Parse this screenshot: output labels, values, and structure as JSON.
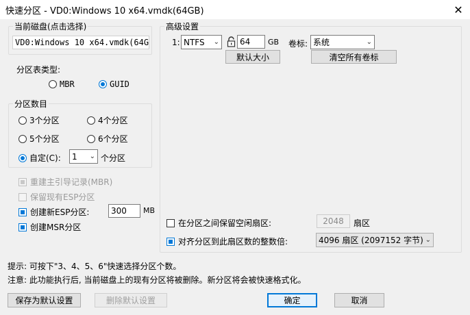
{
  "window": {
    "title": "快速分区 - VD0:Windows 10 x64.vmdk(64GB)",
    "close_glyph": "✕"
  },
  "disk_group": {
    "legend": "当前磁盘(点击选择)",
    "disk_name": "VD0:Windows 10 x64.vmdk(64G"
  },
  "partition_type": {
    "label": "分区表类型:",
    "options": [
      {
        "label": "MBR",
        "selected": false
      },
      {
        "label": "GUID",
        "selected": true
      }
    ]
  },
  "partition_count": {
    "legend": "分区数目",
    "options": [
      "3个分区",
      "4个分区",
      "5个分区",
      "6个分区"
    ],
    "custom_label": "自定(C):",
    "custom_value": "1",
    "custom_suffix": "个分区"
  },
  "options": {
    "rebuild_mbr": "重建主引导记录(MBR)",
    "keep_esp": "保留现有ESP分区",
    "create_esp": "创建新ESP分区:",
    "esp_size": "300",
    "esp_unit": "MB",
    "create_msr": "创建MSR分区"
  },
  "advanced": {
    "legend": "高级设置",
    "row_index": "1:",
    "fs_value": "NTFS",
    "lock_icon": "lock-icon",
    "size_value": "64",
    "size_unit": "GB",
    "volume_label_caption": "卷标:",
    "volume_label_value": "系统",
    "default_size_button": "默认大小",
    "clear_labels_button": "清空所有卷标"
  },
  "reserve": {
    "label": "在分区之间保留空闲扇区:",
    "value": "2048",
    "unit": "扇区"
  },
  "align": {
    "label": "对齐分区到此扇区数的整数倍:",
    "value": "4096 扇区 (2097152 字节)"
  },
  "hints": {
    "tip": "提示: 可按下\"3、4、5、6\"快速选择分区个数。",
    "warning": "注意: 此功能执行后, 当前磁盘上的现有分区将被删除。新分区将会被快速格式化。"
  },
  "buttons": {
    "save_default": "保存为默认设置",
    "delete_default": "删除默认设置",
    "ok": "确定",
    "cancel": "取消"
  },
  "colors": {
    "accent": "#0078d7",
    "dialog_bg": "#f0f0f0"
  }
}
